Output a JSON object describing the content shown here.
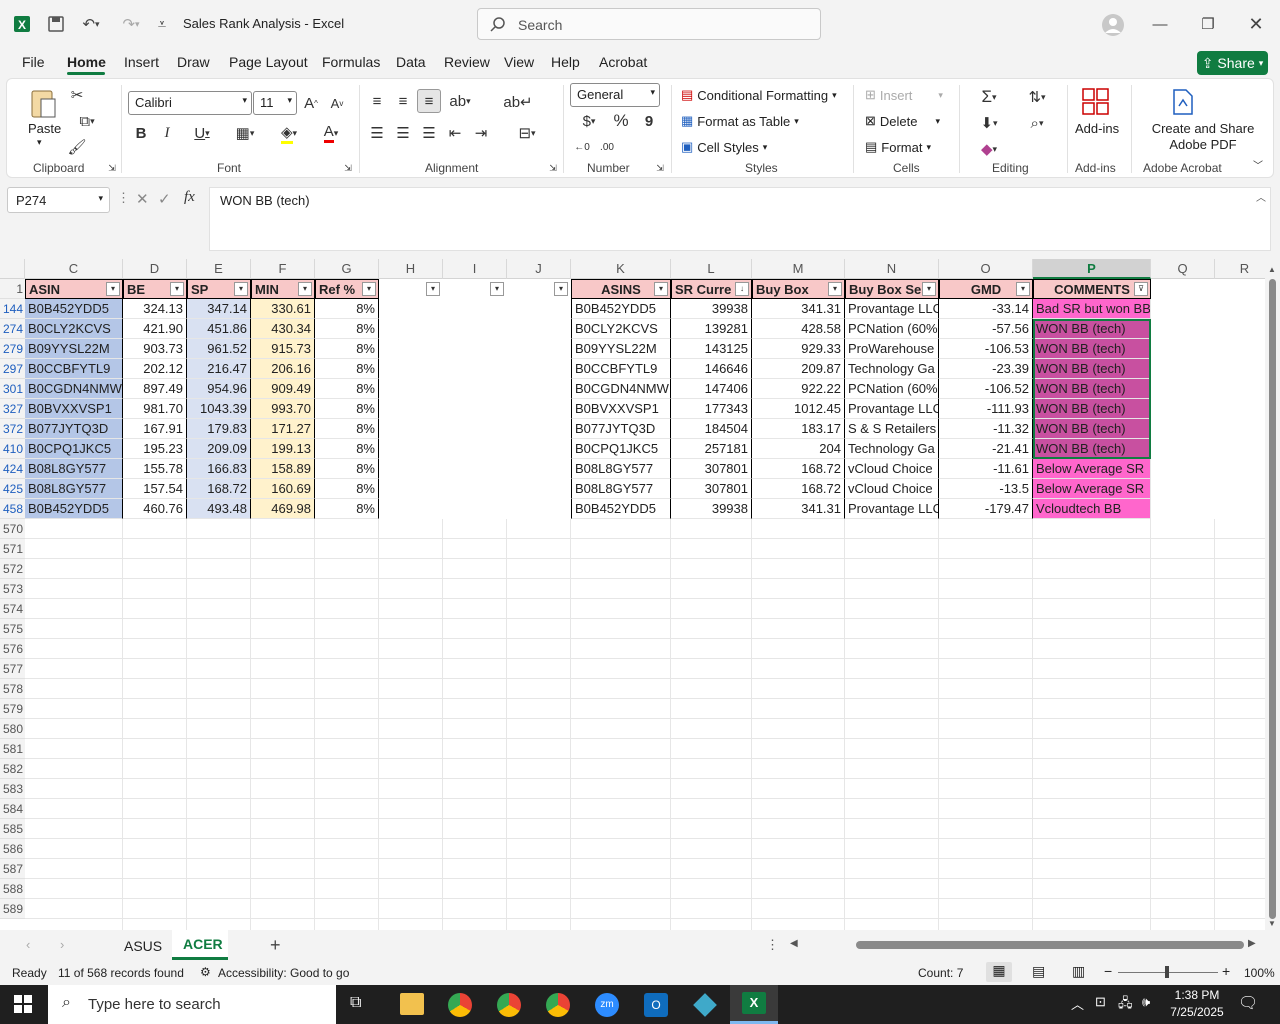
{
  "window": {
    "title": "Sales Rank Analysis  -  Excel",
    "search_placeholder": "Search"
  },
  "tabs": [
    "File",
    "Home",
    "Insert",
    "Draw",
    "Page Layout",
    "Formulas",
    "Data",
    "Review",
    "View",
    "Help",
    "Acrobat"
  ],
  "share_label": "Share",
  "ribbon": {
    "clipboard": {
      "paste": "Paste",
      "label": "Clipboard"
    },
    "font": {
      "name": "Calibri",
      "size": "11",
      "label": "Font"
    },
    "alignment": {
      "label": "Alignment"
    },
    "number": {
      "format": "General",
      "label": "Number"
    },
    "styles": {
      "conditional": "Conditional Formatting",
      "format_table": "Format as Table",
      "cell_styles": "Cell Styles",
      "label": "Styles"
    },
    "cells": {
      "insert": "Insert",
      "delete": "Delete",
      "format": "Format",
      "label": "Cells"
    },
    "editing": {
      "label": "Editing"
    },
    "addins": {
      "button": "Add-ins",
      "label": "Add-ins"
    },
    "acrobat": {
      "button": "Create and Share Adobe PDF",
      "label": "Adobe Acrobat"
    }
  },
  "formula_bar": {
    "namebox": "P274",
    "formula": "WON BB (tech)"
  },
  "columns": [
    "C",
    "D",
    "E",
    "F",
    "G",
    "H",
    "I",
    "J",
    "K",
    "L",
    "M",
    "N",
    "O",
    "P",
    "Q",
    "R"
  ],
  "headers_left": [
    "ASIN",
    "BE",
    "SP",
    "MIN",
    "Ref %"
  ],
  "headers_right": [
    "ASINS",
    "SR Curre",
    "Buy Box",
    "Buy Box Sell",
    "GMD",
    "COMMENTS"
  ],
  "row_numbers": [
    "1",
    "144",
    "274",
    "279",
    "297",
    "301",
    "327",
    "372",
    "410",
    "424",
    "425",
    "458",
    "570",
    "571",
    "572",
    "573",
    "574",
    "575",
    "576",
    "577",
    "578",
    "579",
    "580",
    "581",
    "582",
    "583",
    "584",
    "585",
    "586",
    "587",
    "588",
    "589"
  ],
  "rows": [
    {
      "asin": "B0B452YDD5",
      "be": "324.13",
      "sp": "347.14",
      "min": "330.61",
      "ref": "8%",
      "asins": "B0B452YDD5",
      "sr": "39938",
      "bb": "341.31",
      "seller": "Provantage LLC",
      "gmd": "-33.14",
      "comment": "Bad SR but won BB"
    },
    {
      "asin": "B0CLY2KCVS",
      "be": "421.90",
      "sp": "451.86",
      "min": "430.34",
      "ref": "8%",
      "asins": "B0CLY2KCVS",
      "sr": "139281",
      "bb": "428.58",
      "seller": "PCNation (60%",
      "gmd": "-57.56",
      "comment": "WON BB (tech)"
    },
    {
      "asin": "B09YYSL22M",
      "be": "903.73",
      "sp": "961.52",
      "min": "915.73",
      "ref": "8%",
      "asins": "B09YYSL22M",
      "sr": "143125",
      "bb": "929.33",
      "seller": "ProWarehouse",
      "gmd": "-106.53",
      "comment": "WON BB (tech)"
    },
    {
      "asin": "B0CCBFYTL9",
      "be": "202.12",
      "sp": "216.47",
      "min": "206.16",
      "ref": "8%",
      "asins": "B0CCBFYTL9",
      "sr": "146646",
      "bb": "209.87",
      "seller": "Technology Ga",
      "gmd": "-23.39",
      "comment": "WON BB (tech)"
    },
    {
      "asin": "B0CGDN4NMW",
      "be": "897.49",
      "sp": "954.96",
      "min": "909.49",
      "ref": "8%",
      "asins": "B0CGDN4NMW",
      "sr": "147406",
      "bb": "922.22",
      "seller": "PCNation (60%",
      "gmd": "-106.52",
      "comment": "WON BB (tech)"
    },
    {
      "asin": "B0BVXXVSP1",
      "be": "981.70",
      "sp": "1043.39",
      "min": "993.70",
      "ref": "8%",
      "asins": "B0BVXXVSP1",
      "sr": "177343",
      "bb": "1012.45",
      "seller": "Provantage LLC",
      "gmd": "-111.93",
      "comment": "WON BB (tech)"
    },
    {
      "asin": "B077JYTQ3D",
      "be": "167.91",
      "sp": "179.83",
      "min": "171.27",
      "ref": "8%",
      "asins": "B077JYTQ3D",
      "sr": "184504",
      "bb": "183.17",
      "seller": "S & S Retailers",
      "gmd": "-11.32",
      "comment": "WON BB (tech)"
    },
    {
      "asin": "B0CPQ1JKC5",
      "be": "195.23",
      "sp": "209.09",
      "min": "199.13",
      "ref": "8%",
      "asins": "B0CPQ1JKC5",
      "sr": "257181",
      "bb": "204",
      "seller": "Technology Ga",
      "gmd": "-21.41",
      "comment": "WON BB (tech)"
    },
    {
      "asin": "B08L8GY577",
      "be": "155.78",
      "sp": "166.83",
      "min": "158.89",
      "ref": "8%",
      "asins": "B08L8GY577",
      "sr": "307801",
      "bb": "168.72",
      "seller": "vCloud Choice",
      "gmd": "-11.61",
      "comment": "Below Average SR"
    },
    {
      "asin": "B08L8GY577",
      "be": "157.54",
      "sp": "168.72",
      "min": "160.69",
      "ref": "8%",
      "asins": "B08L8GY577",
      "sr": "307801",
      "bb": "168.72",
      "seller": "vCloud Choice",
      "gmd": "-13.5",
      "comment": "Below Average SR"
    },
    {
      "asin": "B0B452YDD5",
      "be": "460.76",
      "sp": "493.48",
      "min": "469.98",
      "ref": "8%",
      "asins": "B0B452YDD5",
      "sr": "39938",
      "bb": "341.31",
      "seller": "Provantage LLC",
      "gmd": "-179.47",
      "comment": "Vcloudtech BB"
    }
  ],
  "sheets": [
    "ASUS",
    "ACER"
  ],
  "active_sheet": "ACER",
  "status": {
    "mode": "Ready",
    "records": "11 of 568 records found",
    "accessibility": "Accessibility: Good to go",
    "count": "Count: 7",
    "zoom": "100%"
  },
  "taskbar": {
    "search_placeholder": "Type here to search",
    "time": "1:38 PM",
    "date": "7/25/2025"
  },
  "colors": {
    "excel_green": "#107c41",
    "header_pink": "#f8c8c8",
    "asin_blue": "#b4c6e7",
    "sp_blue": "#d9e1f2",
    "min_yellow": "#fff2cc",
    "comment_pink": "#ff66cc",
    "comment_selected": "#c850a0"
  }
}
